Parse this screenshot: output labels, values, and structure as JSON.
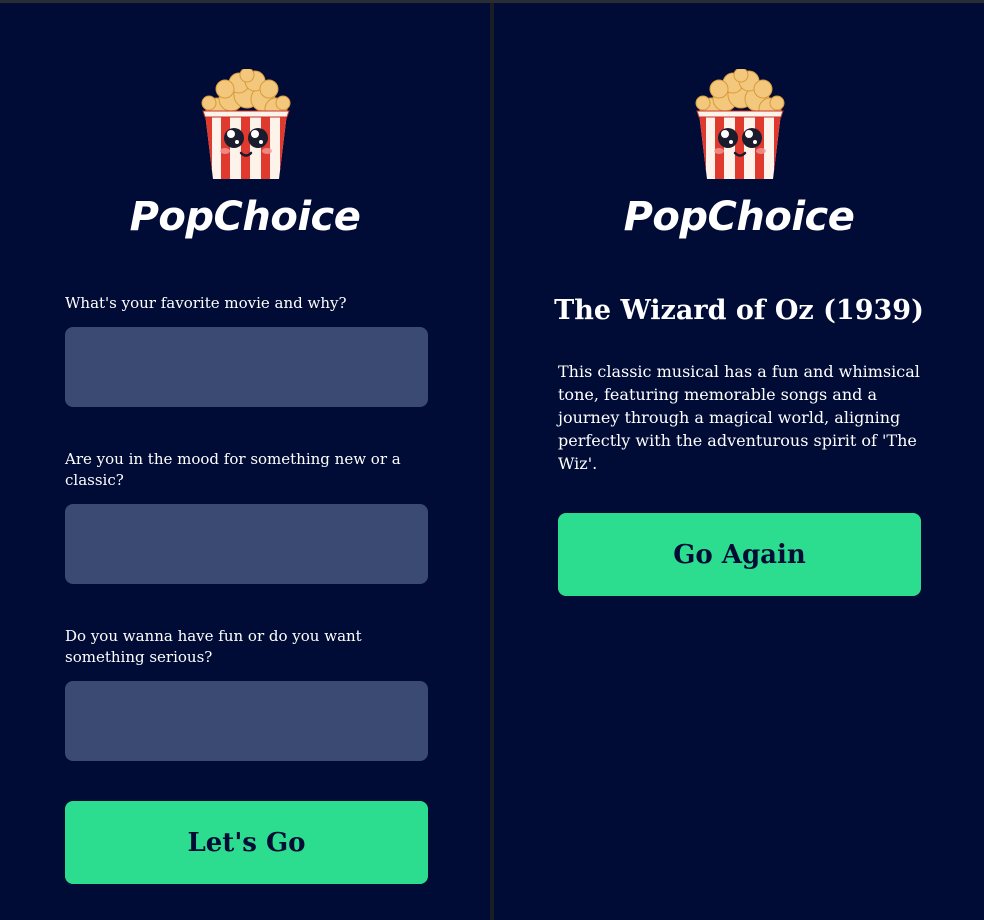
{
  "app": {
    "name": "PopChoice",
    "logo_icon": "popcorn-mascot-icon",
    "colors": {
      "background": "#000c36",
      "input": "#3b4a73",
      "accent": "#2ddd8f",
      "text": "#ffffff"
    }
  },
  "form": {
    "questions": [
      {
        "label": "What's your favorite movie and why?",
        "value": ""
      },
      {
        "label": "Are you in the mood for something new or a classic?",
        "value": ""
      },
      {
        "label": "Do you wanna have fun or do you want something serious?",
        "value": ""
      }
    ],
    "submit_label": "Let's Go"
  },
  "result": {
    "title": "The Wizard of Oz (1939)",
    "description": "This classic musical has a fun and whimsical tone, featuring memorable songs and a journey through a magical world, aligning perfectly with the adventurous spirit of 'The Wiz'.",
    "again_label": "Go Again"
  }
}
